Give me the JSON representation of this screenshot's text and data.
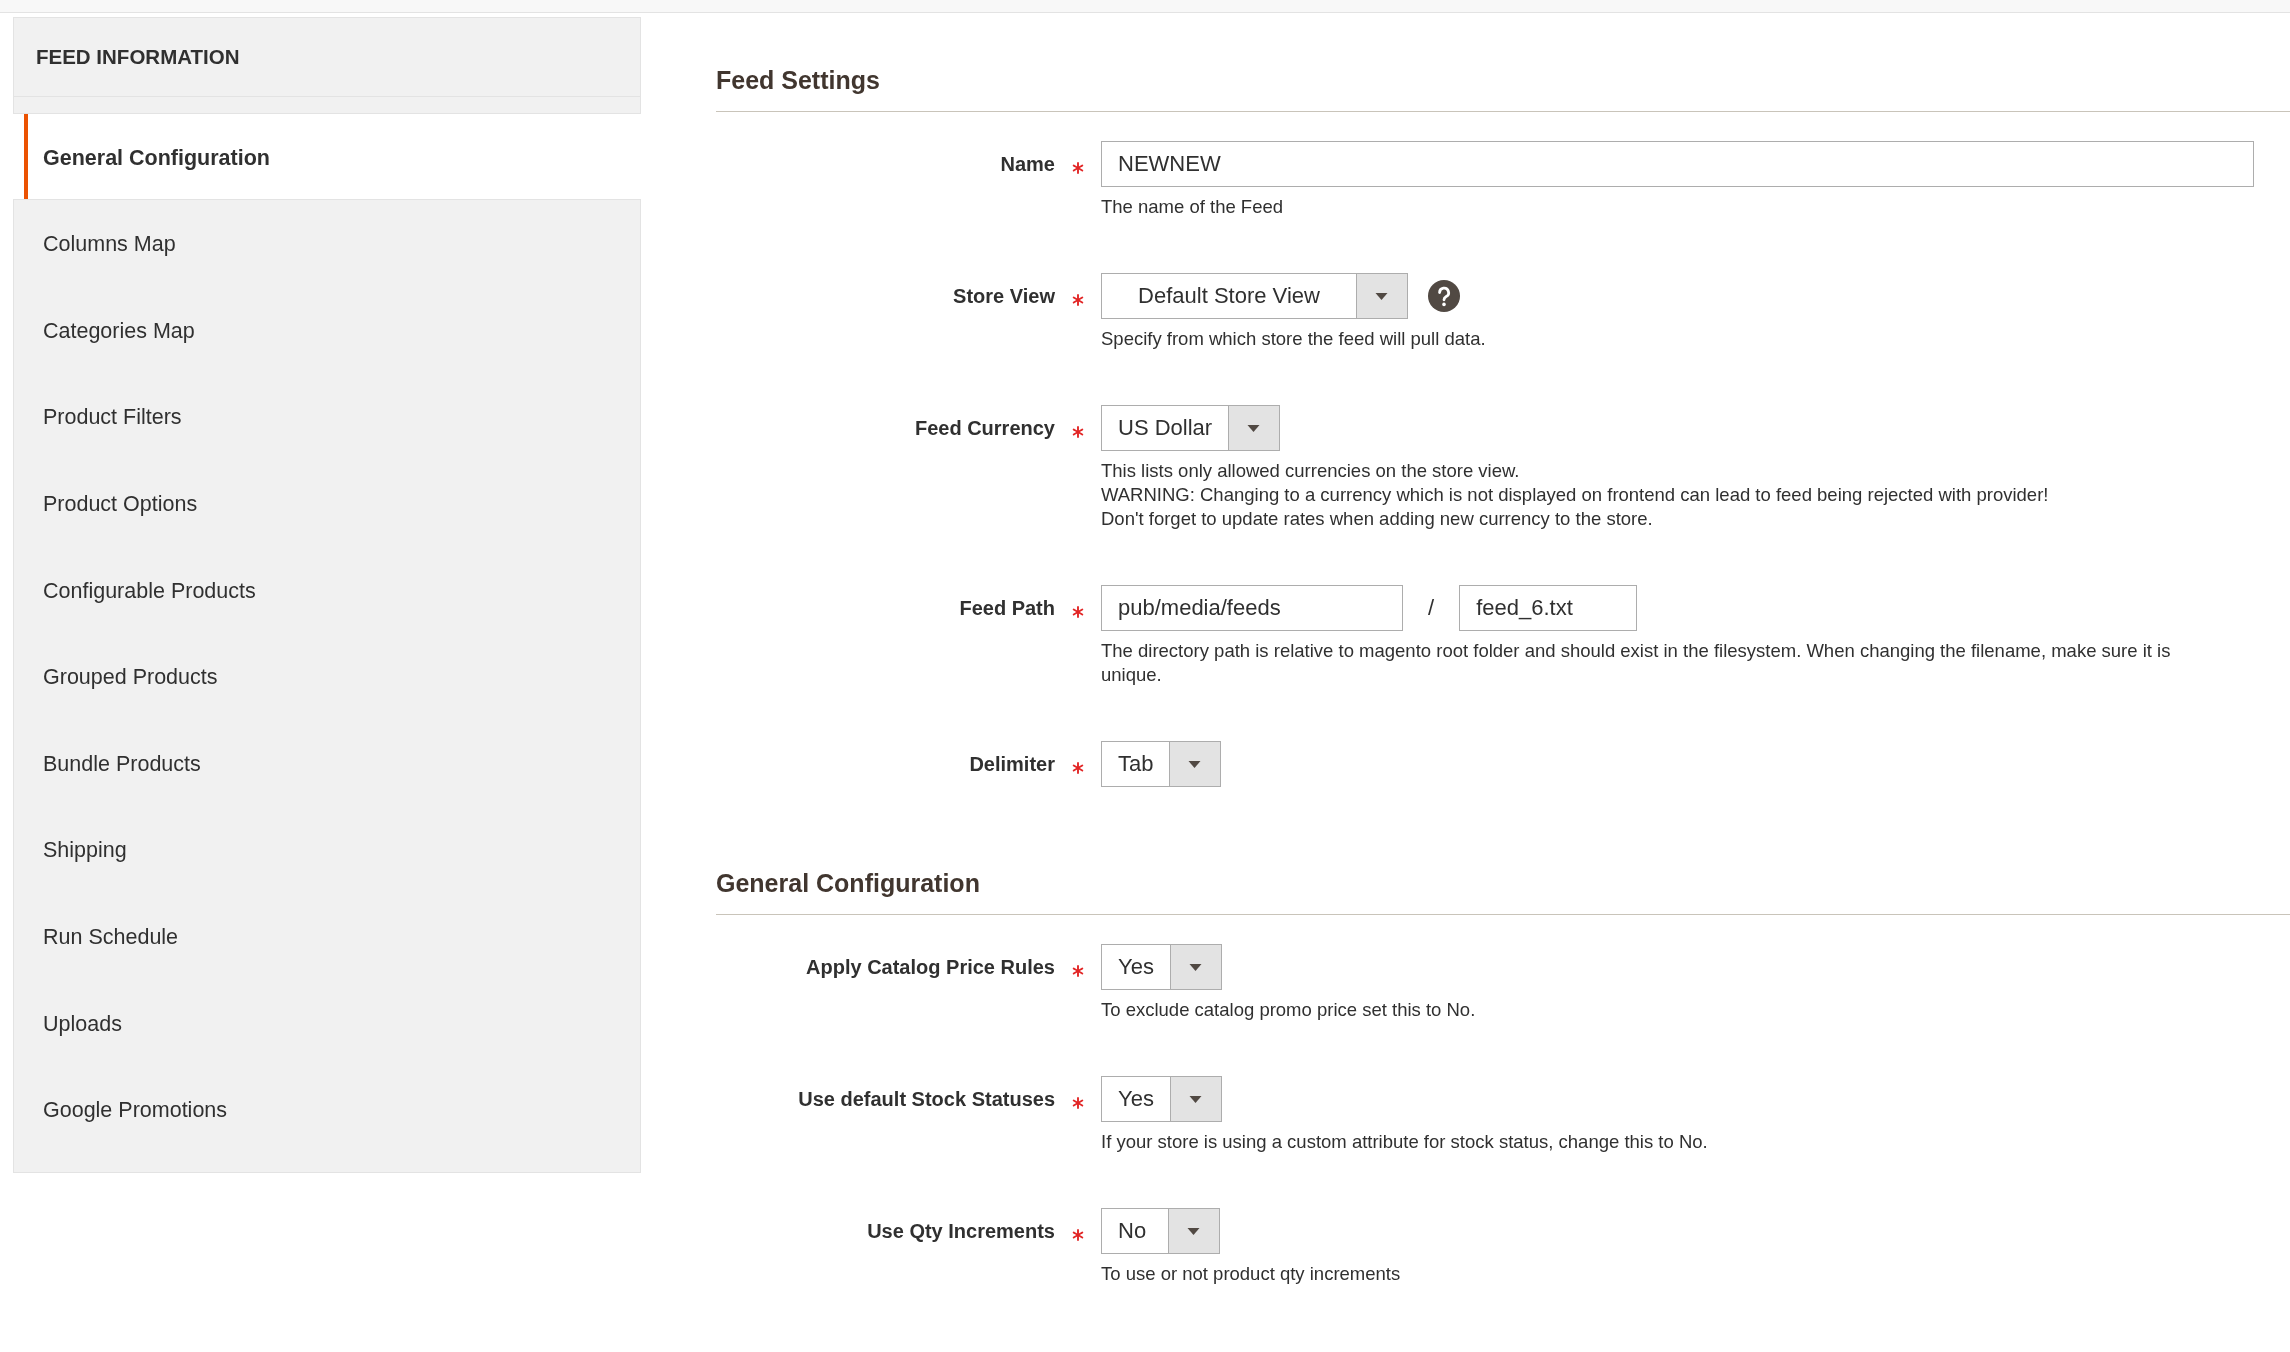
{
  "sidebar": {
    "title": "FEED INFORMATION",
    "items": [
      {
        "label": "General Configuration",
        "selected": true
      },
      {
        "label": "Columns Map",
        "selected": false
      },
      {
        "label": "Categories Map",
        "selected": false
      },
      {
        "label": "Product Filters",
        "selected": false
      },
      {
        "label": "Product Options",
        "selected": false
      },
      {
        "label": "Configurable Products",
        "selected": false
      },
      {
        "label": "Grouped Products",
        "selected": false
      },
      {
        "label": "Bundle Products",
        "selected": false
      },
      {
        "label": "Shipping",
        "selected": false
      },
      {
        "label": "Run Schedule",
        "selected": false
      },
      {
        "label": "Uploads",
        "selected": false
      },
      {
        "label": "Google Promotions",
        "selected": false
      }
    ]
  },
  "sections": [
    {
      "title": "Feed Settings",
      "fields": [
        {
          "kind": "text",
          "label": "Name",
          "required": true,
          "value": "NEWNEW",
          "hint": [
            "The name of the Feed"
          ]
        },
        {
          "kind": "dropdown",
          "label": "Store View",
          "required": true,
          "help": true,
          "value": "Default Store View",
          "hint": [
            "Specify from which store the feed will pull data."
          ]
        },
        {
          "kind": "select",
          "label": "Feed Currency",
          "required": true,
          "value": "US Dollar",
          "hint": [
            "This lists only allowed currencies on the store view.",
            "WARNING: Changing to a currency which is not displayed on frontend can lead to feed being rejected with provider!",
            "Don't forget to update rates when adding new currency to the store."
          ]
        },
        {
          "kind": "path",
          "label": "Feed Path",
          "required": true,
          "values": [
            "pub/media/feeds",
            "feed_6.txt"
          ],
          "separator": "/",
          "hint": [
            "The directory path is relative to magento root folder and should exist in the filesystem. When changing the filename, make sure it is unique."
          ]
        },
        {
          "kind": "select",
          "label": "Delimiter",
          "required": true,
          "value": "Tab"
        }
      ]
    },
    {
      "title": "General Configuration",
      "fields": [
        {
          "kind": "select",
          "label": "Apply Catalog Price Rules",
          "required": true,
          "value": "Yes",
          "hint": [
            "To exclude catalog promo price set this to No."
          ]
        },
        {
          "kind": "select",
          "label": "Use default Stock Statuses",
          "required": true,
          "value": "Yes",
          "hint": [
            "If your store is using a custom attribute for stock status, change this to No."
          ]
        },
        {
          "kind": "select",
          "label": "Use Qty Increments",
          "required": true,
          "value": "No",
          "hint": [
            "To use or not product qty increments"
          ]
        }
      ]
    }
  ]
}
